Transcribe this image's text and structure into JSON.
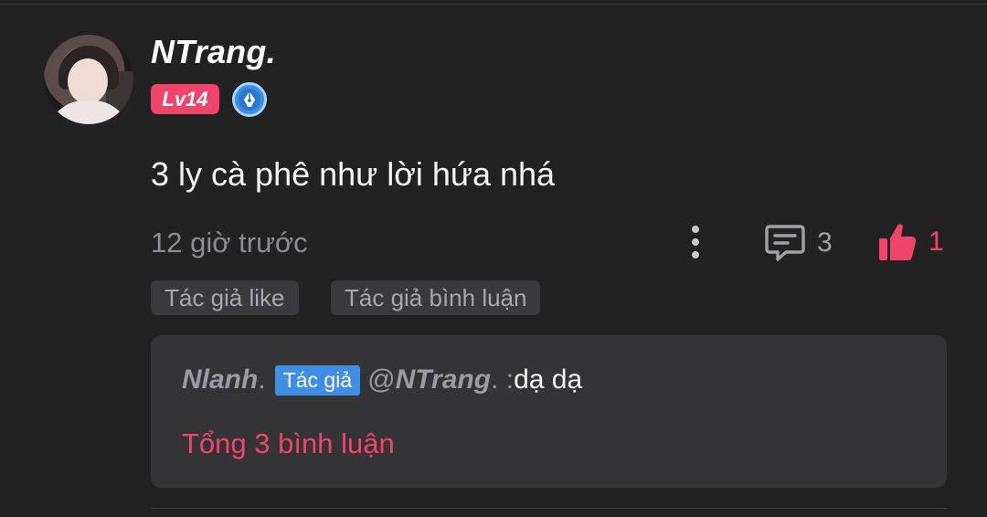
{
  "comment": {
    "username": "NTrang",
    "username_suffix": ".",
    "level": "Lv14",
    "text": "3 ly cà phê như lời hứa nhá",
    "timestamp": "12 giờ trước",
    "comment_count": "3",
    "like_count": "1"
  },
  "tags": {
    "author_like": "Tác giả like",
    "author_reply": "Tác giả bình luận"
  },
  "reply": {
    "author": "Nlanh",
    "author_suffix": ".",
    "author_badge": "Tác giả",
    "mention_prefix": "@",
    "mention_name": "NTrang",
    "mention_suffix": ". : ",
    "text": "dạ dạ",
    "total_label": "Tổng 3 bình luận"
  },
  "colors": {
    "accent": "#f0446a",
    "badge_blue": "#3e8fe4",
    "background": "#222223",
    "reply_background": "#343436"
  },
  "icons": [
    "more-vertical-icon",
    "comment-icon",
    "thumbs-up-icon",
    "pen-badge-icon"
  ]
}
